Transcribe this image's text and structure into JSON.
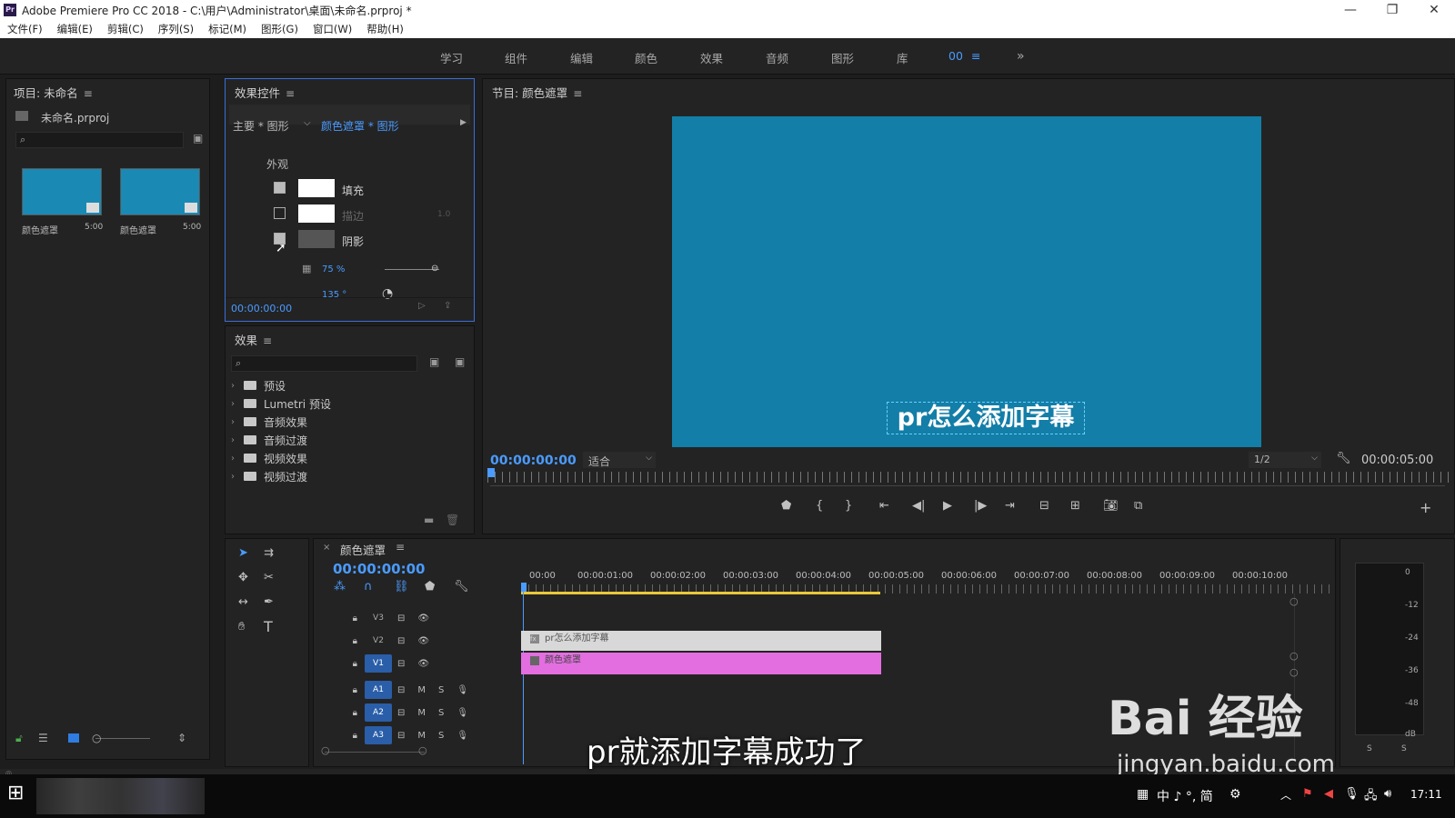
{
  "window": {
    "title": "Adobe Premiere Pro CC 2018 - C:\\用户\\Administrator\\桌面\\未命名.prproj *",
    "logo": "Pr"
  },
  "menu": [
    "文件(F)",
    "编辑(E)",
    "剪辑(C)",
    "序列(S)",
    "标记(M)",
    "图形(G)",
    "窗口(W)",
    "帮助(H)"
  ],
  "workspaces": [
    "学习",
    "组件",
    "编辑",
    "颜色",
    "效果",
    "音频",
    "图形",
    "库",
    "00"
  ],
  "project": {
    "title": "项目: 未命名",
    "file": "未命名.prproj",
    "items": [
      {
        "name": "颜色遮罩",
        "duration": "5:00"
      },
      {
        "name": "颜色遮罩",
        "duration": "5:00"
      }
    ]
  },
  "effect_controls": {
    "title": "效果控件",
    "source": "主要 * 图形",
    "clip": "颜色遮罩 * 图形",
    "section": "外观",
    "rows": [
      {
        "label": "填充",
        "checked": true
      },
      {
        "label": "描边",
        "checked": false,
        "value": "1.0"
      },
      {
        "label": "阴影",
        "checked": true
      }
    ],
    "opacity": "75 %",
    "angle": "135 °",
    "timecode": "00:00:00:00"
  },
  "effects": {
    "title": "效果",
    "folders": [
      "预设",
      "Lumetri 预设",
      "音频效果",
      "音频过渡",
      "视频效果",
      "视频过渡"
    ]
  },
  "program": {
    "title": "节目: 颜色遮罩",
    "caption": "pr怎么添加字幕",
    "timecode": "00:00:00:00",
    "fit": "适合",
    "resolution": "1/2",
    "duration": "00:00:05:00",
    "frame_color": "#137ea7"
  },
  "timeline": {
    "tab": "颜色遮罩",
    "timecode": "00:00:00:00",
    "ruler": [
      "00:00",
      "00:00:01:00",
      "00:00:02:00",
      "00:00:03:00",
      "00:00:04:00",
      "00:00:05:00",
      "00:00:06:00",
      "00:00:07:00",
      "00:00:08:00",
      "00:00:09:00",
      "00:00:10:00"
    ],
    "tracks": [
      "V3",
      "V2",
      "V1",
      "A1",
      "A2",
      "A3"
    ],
    "clips": [
      {
        "name": "pr怎么添加字幕",
        "color": "#d8d8d8"
      },
      {
        "name": "颜色遮罩",
        "color": "#e36ee0"
      }
    ]
  },
  "meter": {
    "labels": [
      "0",
      "-12",
      "-24",
      "-36",
      "-48",
      "dB"
    ],
    "solo": [
      "S",
      "S"
    ]
  },
  "subtitle": "pr就添加字幕成功了",
  "watermark": {
    "brand": "Bai 经验",
    "url": "jingyan.baidu.com"
  },
  "taskbar": {
    "ime": "中 ♪ °, 简",
    "clock": "17:11"
  }
}
